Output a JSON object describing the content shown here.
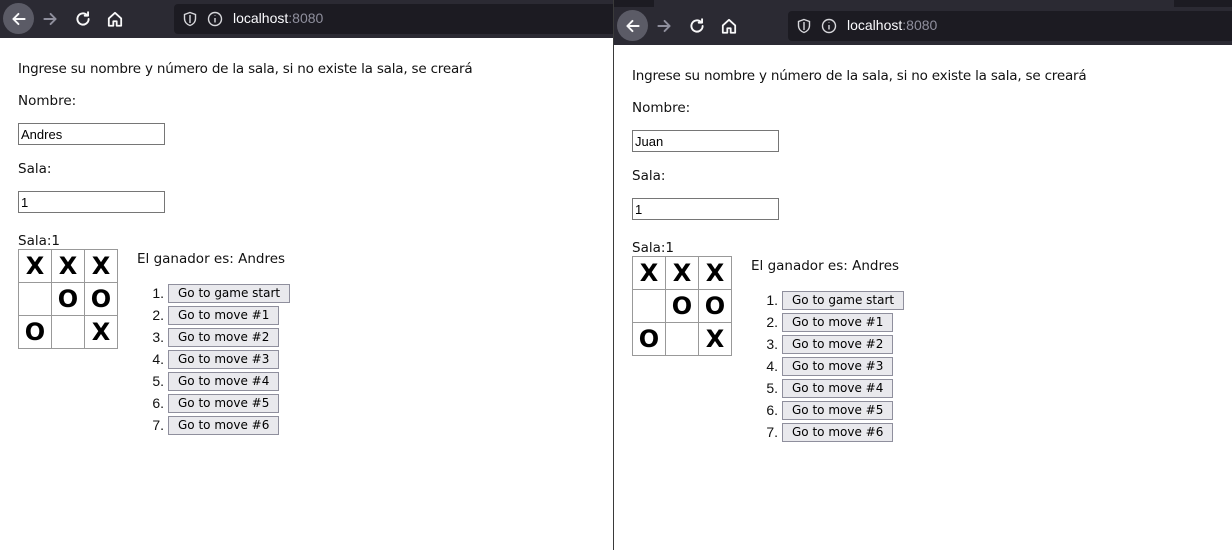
{
  "left": {
    "url_host": "localhost",
    "url_port": ":8080",
    "intro": "Ingrese su nombre y número de la sala, si no existe la sala, se creará",
    "nombre_label": "Nombre:",
    "nombre_value": "Andres",
    "sala_label": "Sala:",
    "sala_value": "1",
    "sala_display_label": "Sala:",
    "sala_display_value": "1",
    "board": [
      [
        "X",
        "X",
        "X"
      ],
      [
        "",
        "O",
        "O"
      ],
      [
        "O",
        "",
        "X"
      ]
    ],
    "winner": "El ganador es: Andres",
    "moves": [
      {
        "num": "1.",
        "label": "Go to game start"
      },
      {
        "num": "2.",
        "label": "Go to move #1"
      },
      {
        "num": "3.",
        "label": "Go to move #2"
      },
      {
        "num": "4.",
        "label": "Go to move #3"
      },
      {
        "num": "5.",
        "label": "Go to move #4"
      },
      {
        "num": "6.",
        "label": "Go to move #5"
      },
      {
        "num": "7.",
        "label": "Go to move #6"
      }
    ]
  },
  "right": {
    "url_host": "localhost",
    "url_port": ":8080",
    "intro": "Ingrese su nombre y número de la sala, si no existe la sala, se creará",
    "nombre_label": "Nombre:",
    "nombre_value": "Juan",
    "sala_label": "Sala:",
    "sala_value": "1",
    "sala_display_label": "Sala:",
    "sala_display_value": "1",
    "board": [
      [
        "X",
        "X",
        "X"
      ],
      [
        "",
        "O",
        "O"
      ],
      [
        "O",
        "",
        "X"
      ]
    ],
    "winner": "El ganador es: Andres",
    "moves": [
      {
        "num": "1.",
        "label": "Go to game start"
      },
      {
        "num": "2.",
        "label": "Go to move #1"
      },
      {
        "num": "3.",
        "label": "Go to move #2"
      },
      {
        "num": "4.",
        "label": "Go to move #3"
      },
      {
        "num": "5.",
        "label": "Go to move #4"
      },
      {
        "num": "6.",
        "label": "Go to move #5"
      },
      {
        "num": "7.",
        "label": "Go to move #6"
      }
    ]
  },
  "icons": {
    "back": "back-arrow-icon",
    "forward": "forward-arrow-icon",
    "reload": "reload-icon",
    "home": "home-icon",
    "shield": "shield-icon",
    "info": "info-icon"
  },
  "colors": {
    "toolbar": "#2b2a33",
    "urlbar": "#1c1b22",
    "port_text": "#8f8f9d",
    "button_bg": "#e9e9ed"
  }
}
